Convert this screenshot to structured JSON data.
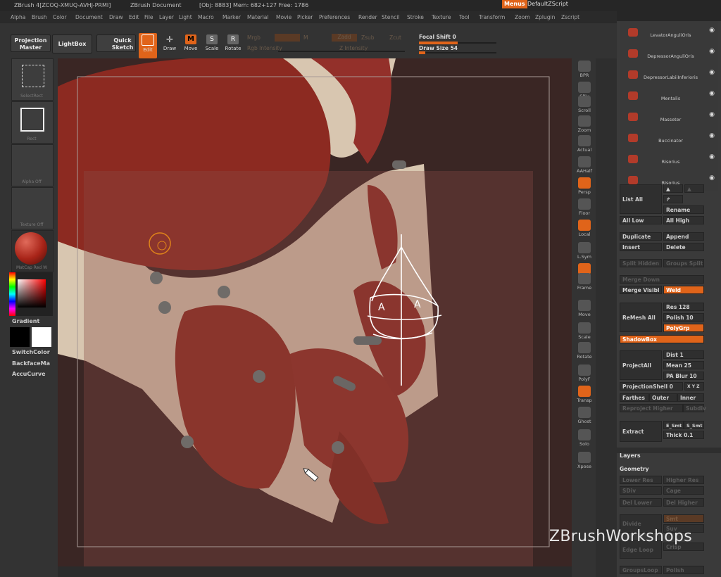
{
  "titlebar": {
    "app": "ZBrush 4[ZCOQ-XMUQ-AVHJ-PRMI]",
    "doc": "ZBrush Document",
    "mem": "[Obj: 8883] Mem: 682+127 Free: 1786",
    "menus": "Menus",
    "script": "DefaultZScript"
  },
  "menubar": [
    "Alpha",
    "Brush",
    "Color",
    "Document",
    "Draw",
    "Edit",
    "File",
    "Layer",
    "Light",
    "Macro",
    "Marker",
    "Material",
    "Movie",
    "Picker",
    "Preferences",
    "Render",
    "Stencil",
    "Stroke",
    "Texture",
    "Tool",
    "Transform",
    "Zoom",
    "Zplugin",
    "Zscript"
  ],
  "toolbar": {
    "projection_master": "Projection Master",
    "lightbox": "LightBox",
    "quick_sketch": "Quick Sketch",
    "edit": "Edit",
    "draw": "Draw",
    "move": "Move",
    "scale": "Scale",
    "rotate": "Rotate",
    "mrgb": "Mrgb",
    "m": "M",
    "rgb_intensity": "Rgb Intensity",
    "zadd": "Zadd",
    "zsub": "Zsub",
    "zcut": "Zcut",
    "z_intensity": "Z Intensity",
    "focal_shift_label": "Focal Shift",
    "focal_shift_value": "0",
    "draw_size_label": "Draw Size",
    "draw_size_value": "54",
    "focal_shift_level": 0.5,
    "draw_size_level": 0.08
  },
  "leftshelf": {
    "select_rect": "SelectRect",
    "rect": "Rect",
    "alpha_off": "Alpha Off",
    "texture_off": "Texture Off",
    "material": "MatCap Red W",
    "gradient": "Gradient",
    "switch_color": "SwitchColor",
    "backface": "BackfaceMa",
    "accucurve": "AccuCurve"
  },
  "rightshelf": [
    "BPR",
    "SPix",
    "Scroll",
    "Zoom",
    "Actual",
    "AAHalf",
    "Persp",
    "Floor",
    "Local",
    "L.Sym",
    "XYZ",
    "Frame",
    "Move",
    "Scale",
    "Rotate",
    "PolyF",
    "Transp",
    "Ghost",
    "Solo",
    "Xpose"
  ],
  "subtools": [
    "LevatorAnguliOris",
    "DepressorAnguliOris",
    "DepressorLabiiInferioris",
    "Mentalis",
    "Masseter",
    "Buccinator",
    "Risorius",
    "Risorius"
  ],
  "palette": {
    "list_all": "List All",
    "rename": "Rename",
    "all_low": "All Low",
    "all_high": "All High",
    "duplicate": "Duplicate",
    "append": "Append",
    "insert": "Insert",
    "delete": "Delete",
    "split_hidden": "Split Hidden",
    "groups_split": "Groups Split",
    "merge_down": "Merge Down",
    "merge_visible": "Merge Visibl",
    "weld": "Weld",
    "remesh_all": "ReMesh All",
    "res": "Res 128",
    "polish": "Polish 10",
    "polygrp": "PolyGrp",
    "shadowbox": "ShadowBox",
    "project_all": "ProjectAll",
    "dist": "Dist 1",
    "mean": "Mean 25",
    "pa_blur": "PA Blur 10",
    "projection_shell": "ProjectionShell 0",
    "xyz": "X Y Z",
    "farthest": "Farthes",
    "outer": "Outer",
    "inner": "Inner",
    "reproject_higher": "Reproject Higher",
    "subdiv": "Subdiv",
    "extract": "Extract",
    "e_smt": "E_Smt",
    "s_smt": "S_Smt",
    "thick": "Thick 0.1",
    "layers": "Layers",
    "geometry": "Geometry",
    "lower_res": "Lower Res",
    "higher_res": "Higher Res",
    "sdiv": "SDiv",
    "cage": "Cage",
    "del_lower": "Del Lower",
    "del_higher": "Del Higher",
    "smt": "Smt",
    "suv": "Suv",
    "divide": "Divide",
    "edge_loop": "Edge Loop",
    "crisp": "Crisp",
    "groups_loops": "GroupsLoop",
    "polish2": "Polish"
  },
  "viewport": {
    "sketch_labels": [
      "A",
      "A"
    ]
  },
  "watermark": "ZBrushWorkshops",
  "colors": {
    "accent": "#e0641a",
    "muscle": "#8f2a22",
    "bone": "#d9c8b4"
  }
}
